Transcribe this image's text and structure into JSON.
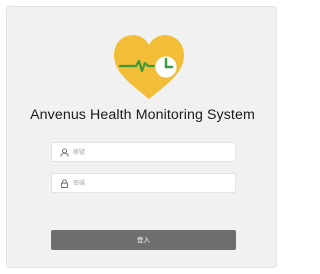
{
  "app": {
    "title": "Anvenus Health Monitoring System"
  },
  "logo": {
    "icon": "heart-clock-logo",
    "colors": {
      "heart": "#f2bd37",
      "pulse": "#3a9a3e",
      "clock_face": "#ffffff"
    }
  },
  "form": {
    "username": {
      "placeholder": "帳號",
      "value": "",
      "icon": "user-icon"
    },
    "password": {
      "placeholder": "密碼",
      "value": "",
      "icon": "lock-icon"
    },
    "login_label": "登入"
  },
  "colors": {
    "background": "#f1f1f1",
    "button": "#6d6e70",
    "button_text": "#ffffff"
  }
}
